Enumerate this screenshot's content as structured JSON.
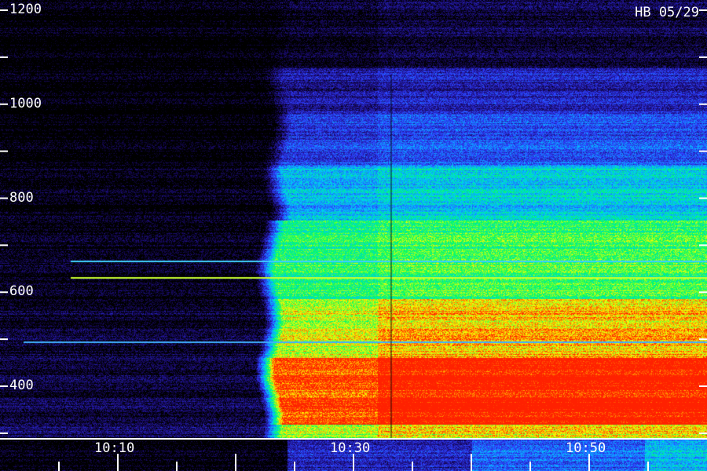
{
  "chart_data": {
    "type": "heatmap",
    "corner_label": "HB 05/29",
    "xlabel": "",
    "ylabel": "",
    "x_range": [
      "10:00",
      "10:59"
    ],
    "x_ticks": [
      "10:10",
      "10:30",
      "10:50"
    ],
    "y_ticks": [
      400,
      600,
      800,
      1000,
      1200
    ],
    "ylim": [
      300,
      1200
    ],
    "colormap": [
      "#000000",
      "#1a0a6e",
      "#2f3cff",
      "#00c8ff",
      "#00ff60",
      "#ffff00",
      "#ff2000"
    ],
    "onset_time": "10:24",
    "second_step_time": "10:32",
    "horizontal_lines": [
      {
        "value": 632,
        "start": "10:06",
        "color": "#c8ff30"
      },
      {
        "value": 667,
        "start": "10:06",
        "color": "#40d0ff"
      },
      {
        "value": 495,
        "start": "10:02",
        "color": "#40b0ff"
      }
    ],
    "grid": false
  }
}
